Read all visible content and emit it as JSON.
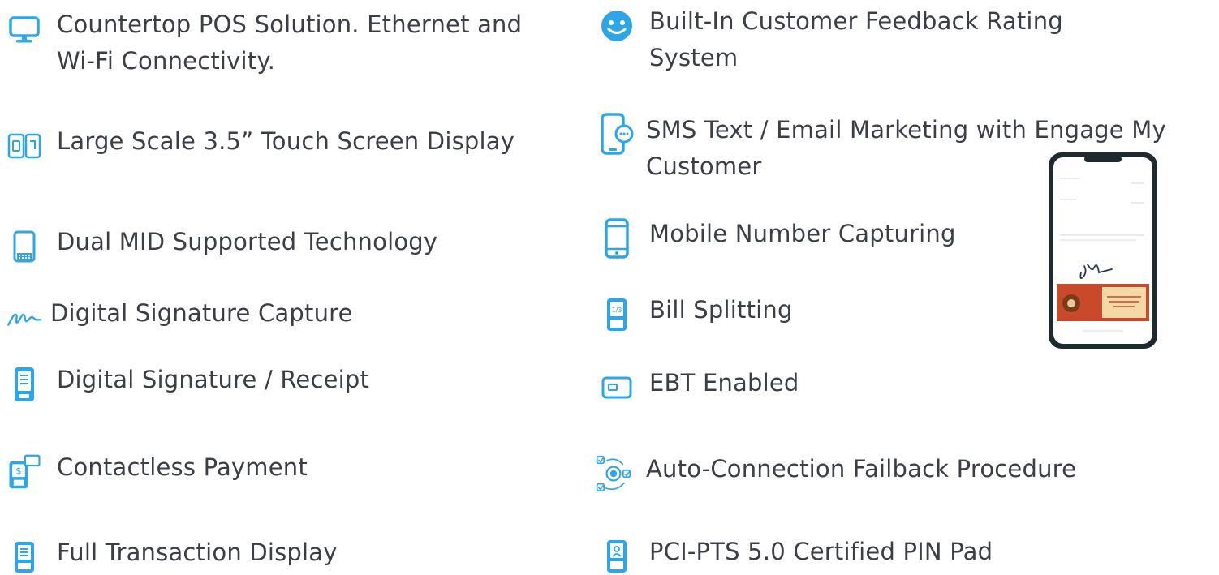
{
  "left_features": [
    {
      "label": "Countertop POS Solution. Ethernet and Wi-Fi Connectivity.",
      "icon": "monitor-icon"
    },
    {
      "label": "Large Scale 3.5” Touch Screen Display",
      "icon": "dual-screen-icon"
    },
    {
      "label": "Dual MID Supported Technology",
      "icon": "terminal-icon"
    },
    {
      "label": "Digital Signature Capture",
      "icon": "signature-icon"
    },
    {
      "label": "Digital Signature / Receipt",
      "icon": "receipt-terminal-icon"
    },
    {
      "label": "Contactless Payment",
      "icon": "contactless-terminal-icon"
    },
    {
      "label": "Full Transaction Display",
      "icon": "transaction-terminal-icon"
    }
  ],
  "right_features": [
    {
      "label": "Built-In Customer Feedback Rating System",
      "icon": "smiley-icon"
    },
    {
      "label": "SMS Text / Email Marketing with Engage My Customer",
      "icon": "phone-chat-icon"
    },
    {
      "label": "Mobile Number Capturing",
      "icon": "mobile-phone-icon"
    },
    {
      "label": "Bill Splitting",
      "icon": "bill-split-terminal-icon"
    },
    {
      "label": "EBT Enabled",
      "icon": "card-icon"
    },
    {
      "label": "Auto-Connection Failback Procedure",
      "icon": "auto-connection-icon"
    },
    {
      "label": "PCI-PTS 5.0 Certified PIN Pad",
      "icon": "pin-pad-icon"
    }
  ],
  "colors": {
    "accent": "#2ea6e6",
    "text": "#3b3e44"
  }
}
